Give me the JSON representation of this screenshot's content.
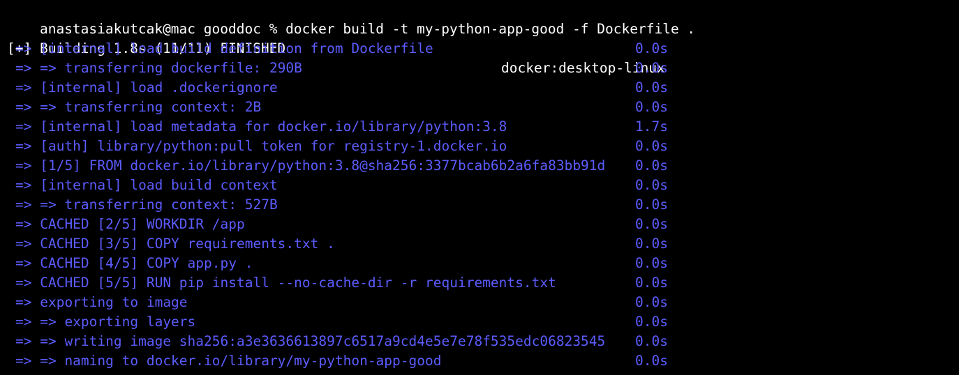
{
  "terminal": {
    "prompt": "anastasiakutcak@mac gooddoc % docker build -t my-python-app-good -f Dockerfile .",
    "header_left": "[+] Building 1.8s (11/11) FINISHED",
    "header_right": "docker:desktop-linux",
    "steps": [
      {
        "text": "=> [internal] load build definition from Dockerfile",
        "time": "0.0s"
      },
      {
        "text": "=> => transferring dockerfile: 290B",
        "time": "0.0s"
      },
      {
        "text": "=> [internal] load .dockerignore",
        "time": "0.0s"
      },
      {
        "text": "=> => transferring context: 2B",
        "time": "0.0s"
      },
      {
        "text": "=> [internal] load metadata for docker.io/library/python:3.8",
        "time": "1.7s"
      },
      {
        "text": "=> [auth] library/python:pull token for registry-1.docker.io",
        "time": "0.0s"
      },
      {
        "text": "=> [1/5] FROM docker.io/library/python:3.8@sha256:3377bcab6b2a6fa83bb91d",
        "time": "0.0s"
      },
      {
        "text": "=> [internal] load build context",
        "time": "0.0s"
      },
      {
        "text": "=> => transferring context: 527B",
        "time": "0.0s"
      },
      {
        "text": "=> CACHED [2/5] WORKDIR /app",
        "time": "0.0s"
      },
      {
        "text": "=> CACHED [3/5] COPY requirements.txt .",
        "time": "0.0s"
      },
      {
        "text": "=> CACHED [4/5] COPY app.py .",
        "time": "0.0s"
      },
      {
        "text": "=> CACHED [5/5] RUN pip install --no-cache-dir -r requirements.txt",
        "time": "0.0s"
      },
      {
        "text": "=> exporting to image",
        "time": "0.0s"
      },
      {
        "text": "=> => exporting layers",
        "time": "0.0s"
      },
      {
        "text": "=> => writing image sha256:a3e3636613897c6517a9cd4e5e7e78f535edc06823545",
        "time": "0.0s"
      },
      {
        "text": "=> => naming to docker.io/library/my-python-app-good",
        "time": "0.0s"
      }
    ]
  },
  "colors": {
    "background": "#000000",
    "foreground": "#ffffff",
    "step": "#5c5cff"
  }
}
